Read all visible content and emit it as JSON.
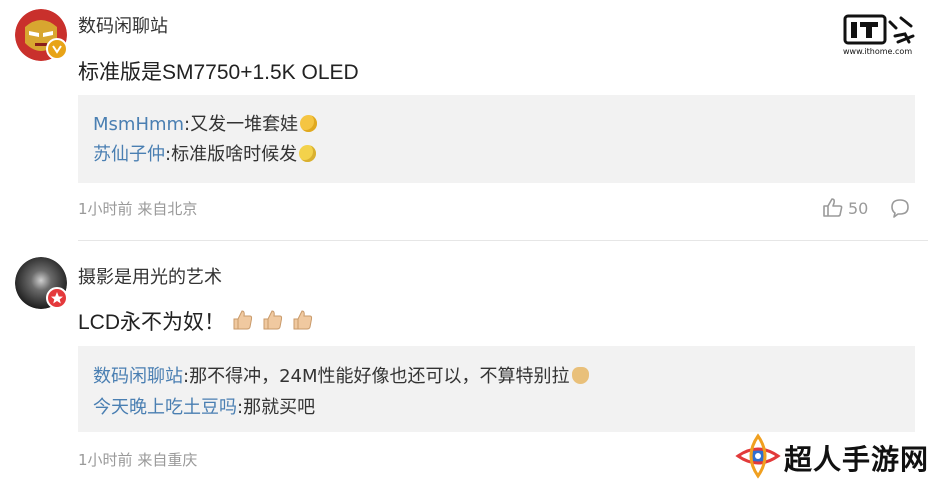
{
  "brand": {
    "logo_text": "IT之家",
    "url": "www.ithome.com"
  },
  "comments": [
    {
      "username": "数码闲聊站",
      "content": "标准版是SM7750+1.5K OLED",
      "replies": [
        {
          "name": "MsmHmm",
          "text": ":又发一堆套娃"
        },
        {
          "name": "苏仙子仲",
          "text": ":标准版啥时候发"
        }
      ],
      "time": "1小时前",
      "location": "来自北京",
      "likes": "50"
    },
    {
      "username": "摄影是用光的艺术",
      "content": "LCD永不为奴！",
      "replies": [
        {
          "name": "数码闲聊站",
          "text": ":那不得冲，24M性能好像也还可以，不算特别拉"
        },
        {
          "name": "今天晚上吃土豆吗",
          "text": ":那就买吧"
        }
      ],
      "time": "1小时前",
      "location": "来自重庆"
    }
  ],
  "watermark": {
    "text": "超人手游网"
  },
  "colors": {
    "reply_name": "#4a7fb2",
    "reply_bg": "#f2f2f2",
    "meta": "#9a9a9a"
  }
}
